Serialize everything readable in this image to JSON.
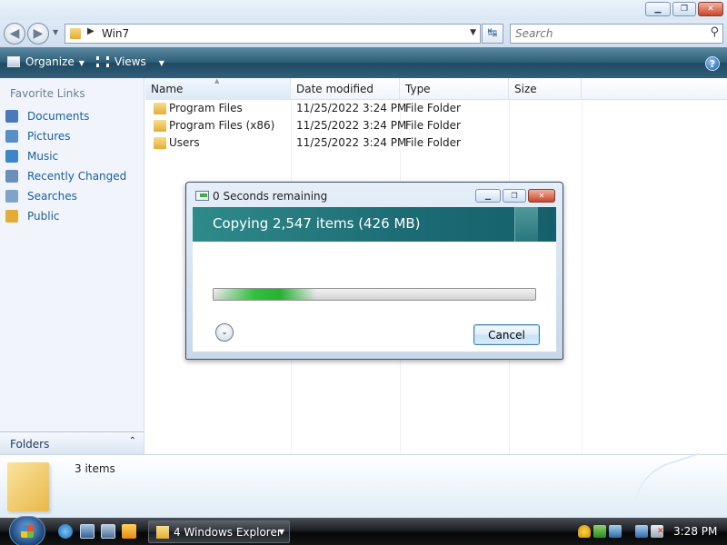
{
  "window": {
    "controls": {
      "minimize": "▁",
      "maximize": "❐",
      "close": "✕"
    }
  },
  "address_bar": {
    "back_glyph": "◀",
    "forward_glyph": "▶",
    "path": "Win7",
    "search_placeholder": "Search",
    "refresh_glyph": "↹"
  },
  "command_bar": {
    "organize": "Organize",
    "views": "Views",
    "help": "?",
    "dropdown_glyph": "▼"
  },
  "nav_pane": {
    "heading": "Favorite Links",
    "items": [
      {
        "label": "Documents",
        "icon": "documents-icon",
        "color": "#4a7ab8"
      },
      {
        "label": "Pictures",
        "icon": "pictures-icon",
        "color": "#5a8fc4"
      },
      {
        "label": "Music",
        "icon": "music-icon",
        "color": "#3f86c8"
      },
      {
        "label": "Recently Changed",
        "icon": "recently-changed-icon",
        "color": "#6a8fb8"
      },
      {
        "label": "Searches",
        "icon": "searches-icon",
        "color": "#7fa3c9"
      },
      {
        "label": "Public",
        "icon": "public-folder-icon",
        "color": "#e3ad35"
      }
    ],
    "folders_label": "Folders",
    "folders_toggle": "⌃"
  },
  "file_list": {
    "columns": {
      "name": "Name",
      "date": "Date modified",
      "type": "Type",
      "size": "Size"
    },
    "sort_indicator": "▲",
    "rows": [
      {
        "name": "Program Files",
        "date": "11/25/2022 3:24 PM",
        "type": "File Folder",
        "size": ""
      },
      {
        "name": "Program Files (x86)",
        "date": "11/25/2022 3:24 PM",
        "type": "File Folder",
        "size": ""
      },
      {
        "name": "Users",
        "date": "11/25/2022 3:24 PM",
        "type": "File Folder",
        "size": ""
      }
    ]
  },
  "details_pane": {
    "item_count": "3 items"
  },
  "copy_dialog": {
    "title": "0 Seconds remaining",
    "heading": "Copying 2,547 items (426 MB)",
    "progress": 0.32,
    "more_details_glyph": "⌄",
    "cancel": "Cancel",
    "controls": {
      "minimize": "▁",
      "restore": "❐",
      "close": "✕"
    }
  },
  "taskbar": {
    "task_label": "4 Windows Explorer",
    "task_dropdown": "▼",
    "clock": "3:28 PM"
  },
  "colors": {
    "command_bar": "#2f5f78",
    "dialog_banner": "#1c6b74",
    "progress_fill": "#31c03d",
    "link_text": "#1a5fa0"
  }
}
